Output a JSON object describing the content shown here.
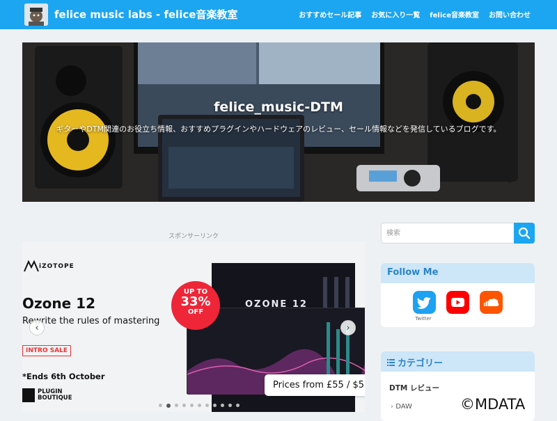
{
  "header": {
    "site_title": "felice music labs - felice音楽教室",
    "nav": [
      "おすすめセール記事",
      "お気に入り一覧",
      "felice音楽教室",
      "お問い合わせ"
    ]
  },
  "hero": {
    "title": "felice_music-DTM",
    "subtitle": "ギターやDTM関連のお役立ち情報、おすすめプラグインやハードウェアのレビュー、セール情報などを発信しているブログです。"
  },
  "sponsor": {
    "label": "スポンサーリンク",
    "ad": {
      "brand": "iZOTOPE",
      "product": "Ozone 12",
      "tagline": "Rewrite the rules of mastering",
      "badge_top": "UP TO",
      "badge_pct": "33%",
      "badge_bottom": "OFF",
      "screen_title": "OZONE 12",
      "intro": "INTRO SALE",
      "ends": "*Ends 6th October",
      "seller": "PLUGIN BOUTIQUE",
      "price": "Prices from £55 / $5",
      "prev": "‹",
      "next": "›",
      "dots": 11,
      "active_dot": 1
    }
  },
  "sidebar": {
    "search_placeholder": "検索",
    "follow": {
      "title": "Follow Me",
      "twitter_label": "Twitter"
    },
    "category": {
      "title": "カテゴリー",
      "items": [
        "DTM レビュー",
        "DAW"
      ]
    }
  },
  "watermark": "©MDATA",
  "colors": {
    "accent": "#1ca5f0",
    "widget_head": "#cde6f8",
    "twitter": "#1da1f2",
    "youtube": "#ff0000",
    "soundcloud": "#ff5500"
  }
}
